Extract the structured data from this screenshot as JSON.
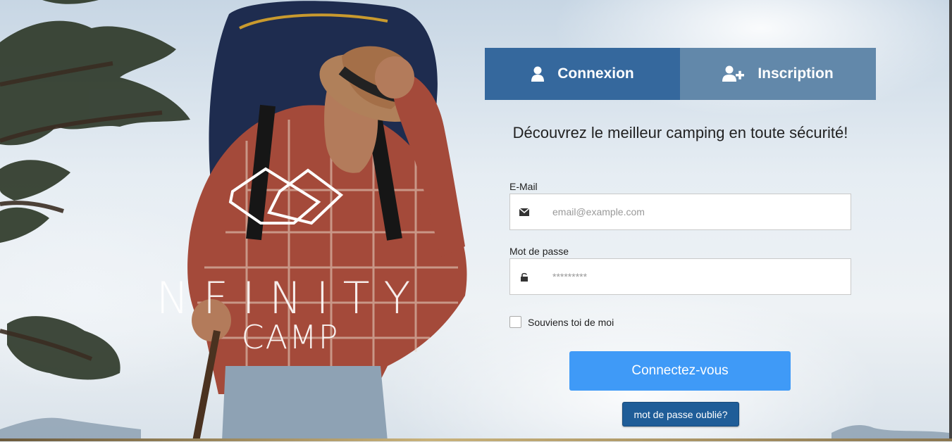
{
  "background": {
    "scene": "hiker-with-backpack-photo"
  },
  "logo": {
    "word": "NFINITY",
    "sub": "CAMP",
    "icon": "infinity-loop-logo"
  },
  "tabs": {
    "login": {
      "label": "Connexion",
      "icon": "user-icon"
    },
    "register": {
      "label": "Inscription",
      "icon": "user-plus-icon"
    }
  },
  "tagline": "Découvrez le meilleur camping en toute sécurité!",
  "form": {
    "email": {
      "label": "E-Mail",
      "placeholder": "email@example.com",
      "value": "",
      "icon": "envelope-icon"
    },
    "password": {
      "label": "Mot de passe",
      "placeholder": "*********",
      "value": "",
      "icon": "unlock-icon"
    },
    "remember": {
      "label": "Souviens toi de moi",
      "checked": false
    },
    "submit_label": "Connectez-vous",
    "forgot_label": "mot de passe oublié?"
  },
  "colors": {
    "tab_login": "#35689d",
    "tab_register": "#6288aa",
    "submit": "#3f9af7",
    "forgot": "#1f5d98"
  }
}
